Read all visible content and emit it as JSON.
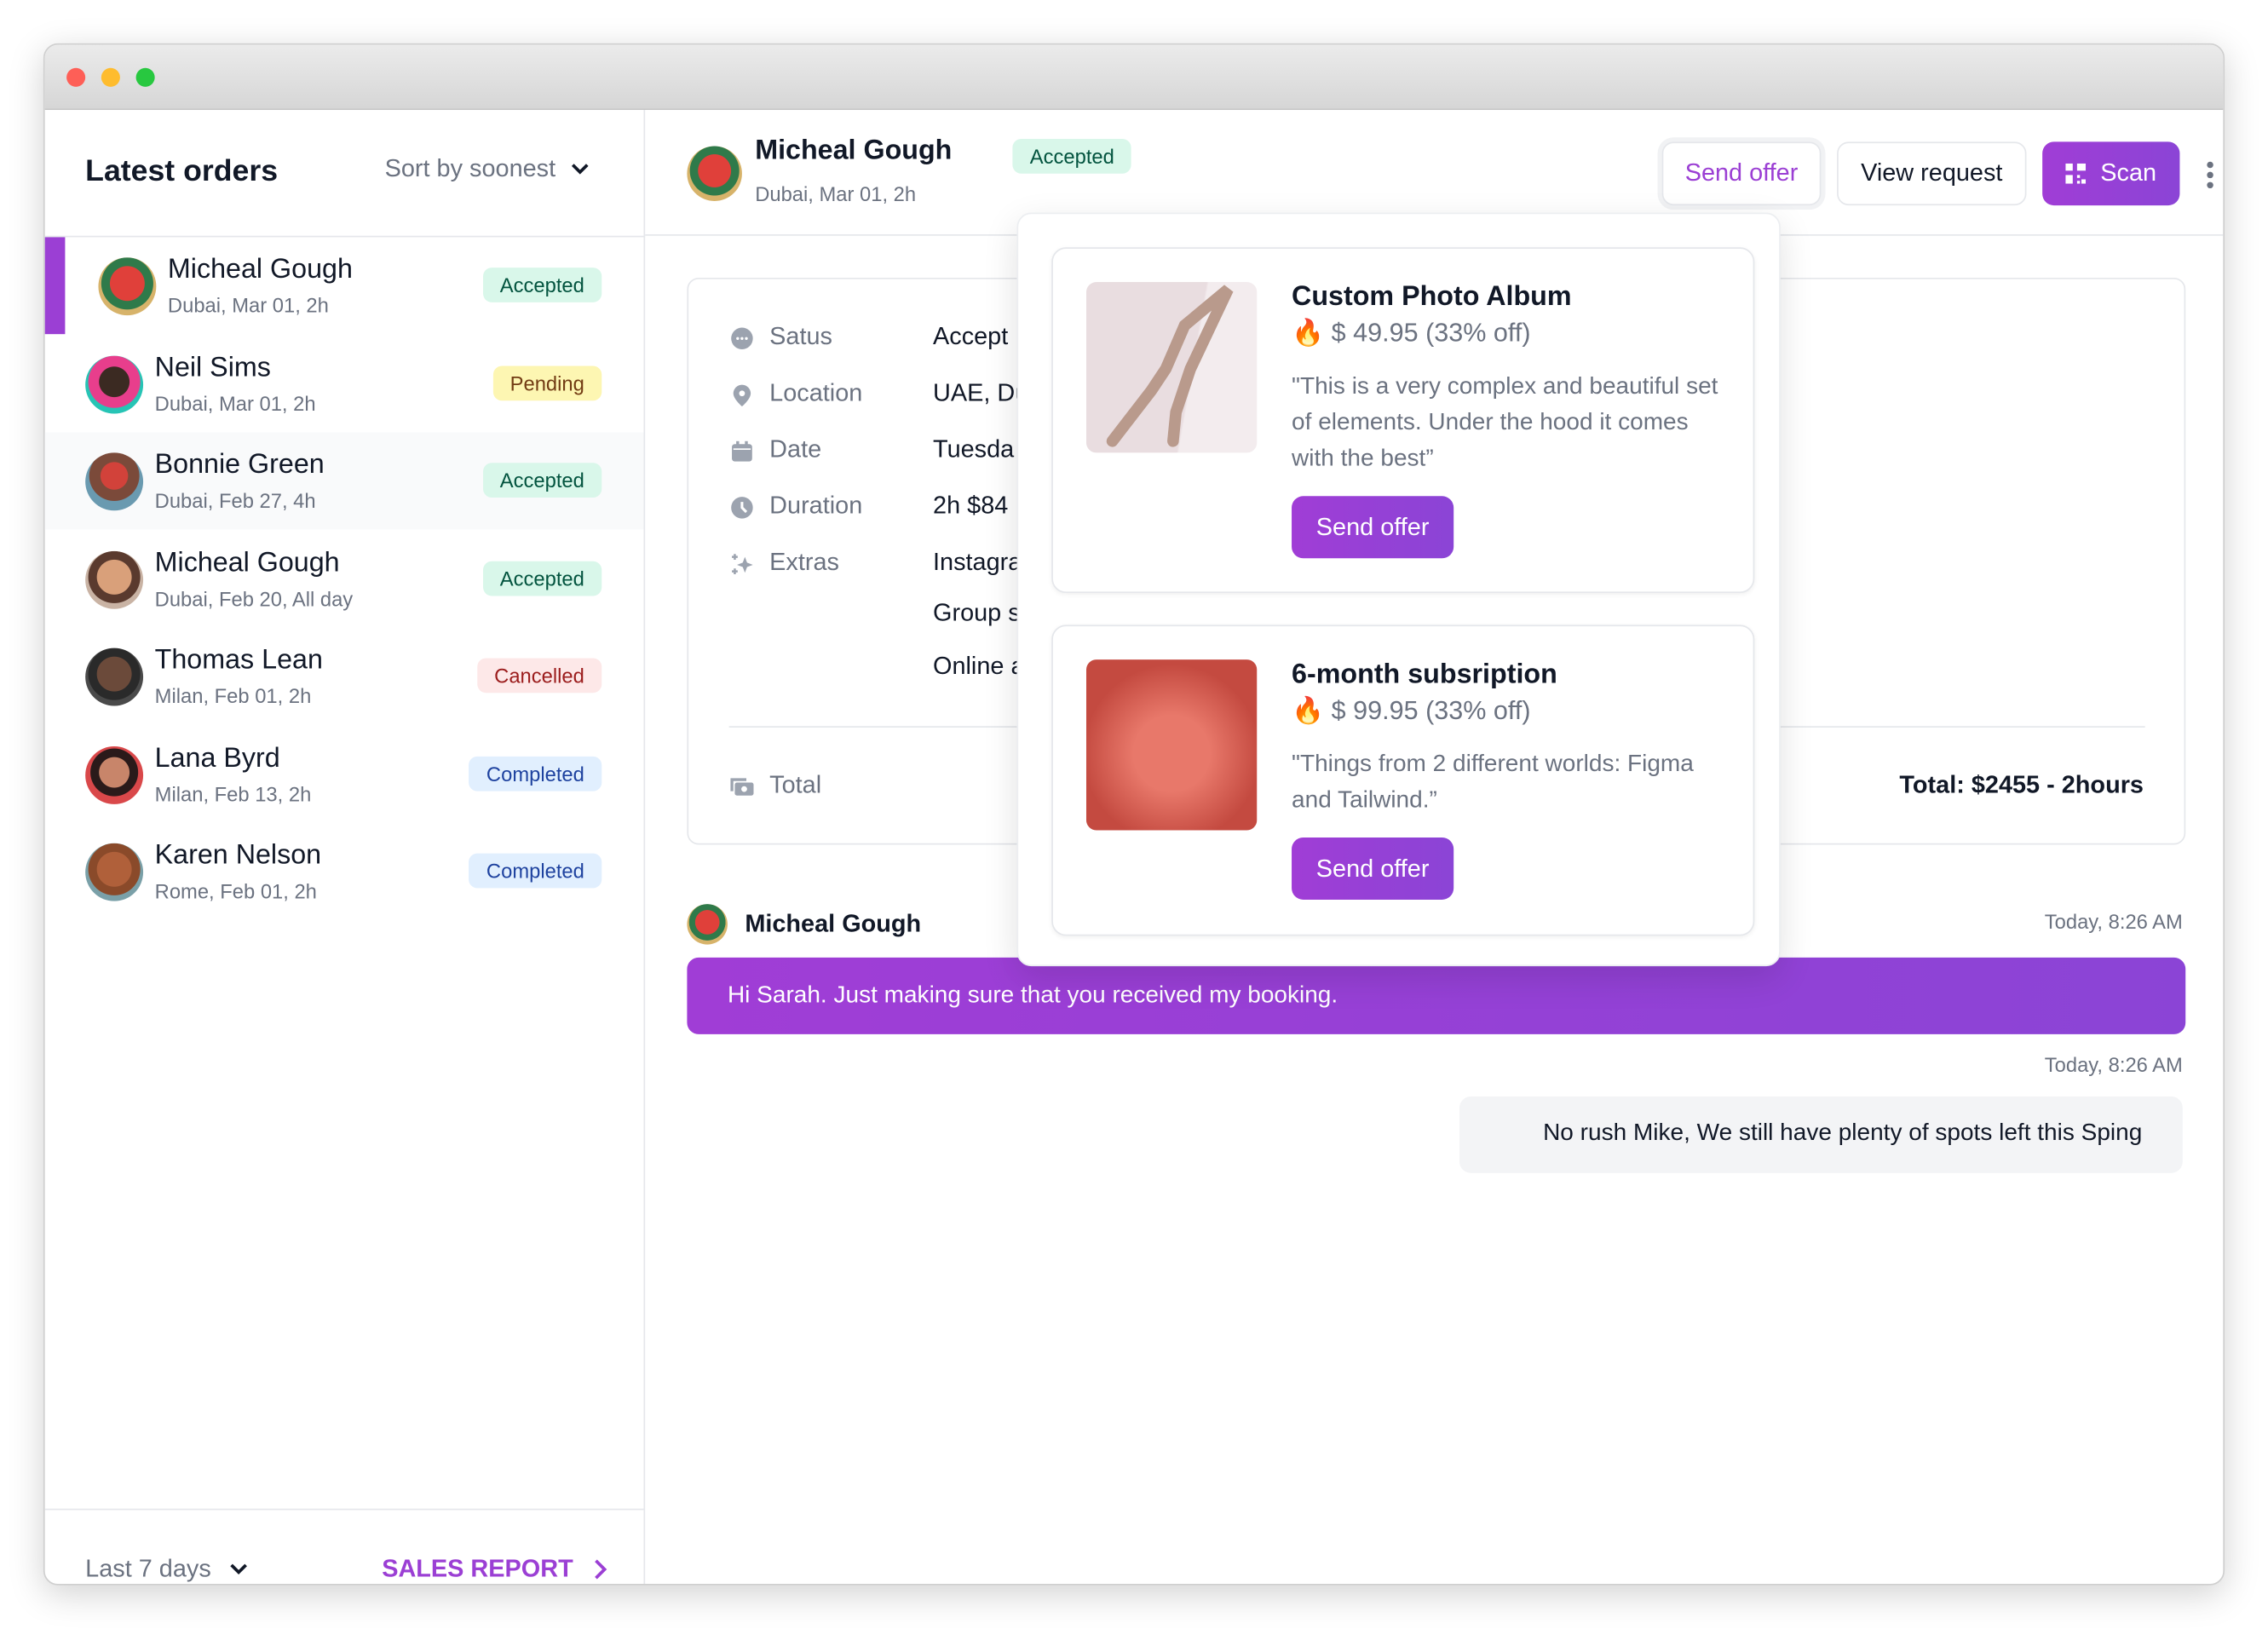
{
  "sidebar": {
    "title": "Latest orders",
    "sort_label": "Sort by soonest",
    "orders": [
      {
        "name": "Micheal Gough",
        "meta": "Dubai, Mar 01, 2h",
        "status": "Accepted"
      },
      {
        "name": "Neil Sims",
        "meta": "Dubai, Mar 01, 2h",
        "status": "Pending"
      },
      {
        "name": "Bonnie Green",
        "meta": "Dubai, Feb 27, 4h",
        "status": "Accepted"
      },
      {
        "name": "Micheal Gough",
        "meta": "Dubai, Feb 20, All day",
        "status": "Accepted"
      },
      {
        "name": "Thomas Lean",
        "meta": "Milan, Feb 01, 2h",
        "status": "Cancelled"
      },
      {
        "name": "Lana Byrd",
        "meta": "Milan, Feb 13, 2h",
        "status": "Completed"
      },
      {
        "name": "Karen Nelson",
        "meta": "Rome, Feb 01, 2h",
        "status": "Completed"
      }
    ],
    "footer": {
      "range_label": "Last 7 days",
      "report_link": "SALES REPORT"
    }
  },
  "header": {
    "name": "Micheal Gough",
    "status": "Accepted",
    "meta": "Dubai, Mar 01, 2h",
    "send_offer": "Send offer",
    "view_request": "View request",
    "scan": "Scan"
  },
  "details": {
    "rows": [
      {
        "label": "Satus",
        "value": "Accept",
        "icon": "chat-dots-icon"
      },
      {
        "label": "Location",
        "value": "UAE, Du",
        "icon": "map-pin-icon"
      },
      {
        "label": "Date",
        "value": "Tuesda",
        "icon": "calendar-icon"
      },
      {
        "label": "Duration",
        "value": "2h $84",
        "icon": "clock-icon"
      },
      {
        "label": "Extras",
        "value": "Instagra",
        "icon": "sparkles-icon"
      }
    ],
    "extras_more": [
      "Group s",
      "Online a"
    ],
    "total_label": "Total",
    "total_value": "Total: $2455 - 2hours"
  },
  "messages": [
    {
      "sender": "Micheal Gough",
      "time": "Today, 8:26 AM",
      "text": "Hi Sarah. Just making sure that you received my booking."
    },
    {
      "time": "Today, 8:26 AM",
      "text": "No rush Mike, We still have plenty of spots left this Sping"
    }
  ],
  "offers": [
    {
      "title": "Custom Photo Album",
      "price": "$ 49.95 (33% off)",
      "description": "\"This is a very complex and beautiful set of elements. Under the hood it comes with the best”",
      "button": "Send offer"
    },
    {
      "title": "6-month subsription",
      "price": "$ 99.95 (33% off)",
      "description": "\"Things from 2 different worlds: Figma and Tailwind.”",
      "button": "Send offer"
    }
  ],
  "colors": {
    "accent": "#9b3fd4",
    "accepted_bg": "#d9f7ea",
    "pending_bg": "#fdf6b2",
    "cancelled_bg": "#fde8e8",
    "completed_bg": "#e1effe"
  }
}
